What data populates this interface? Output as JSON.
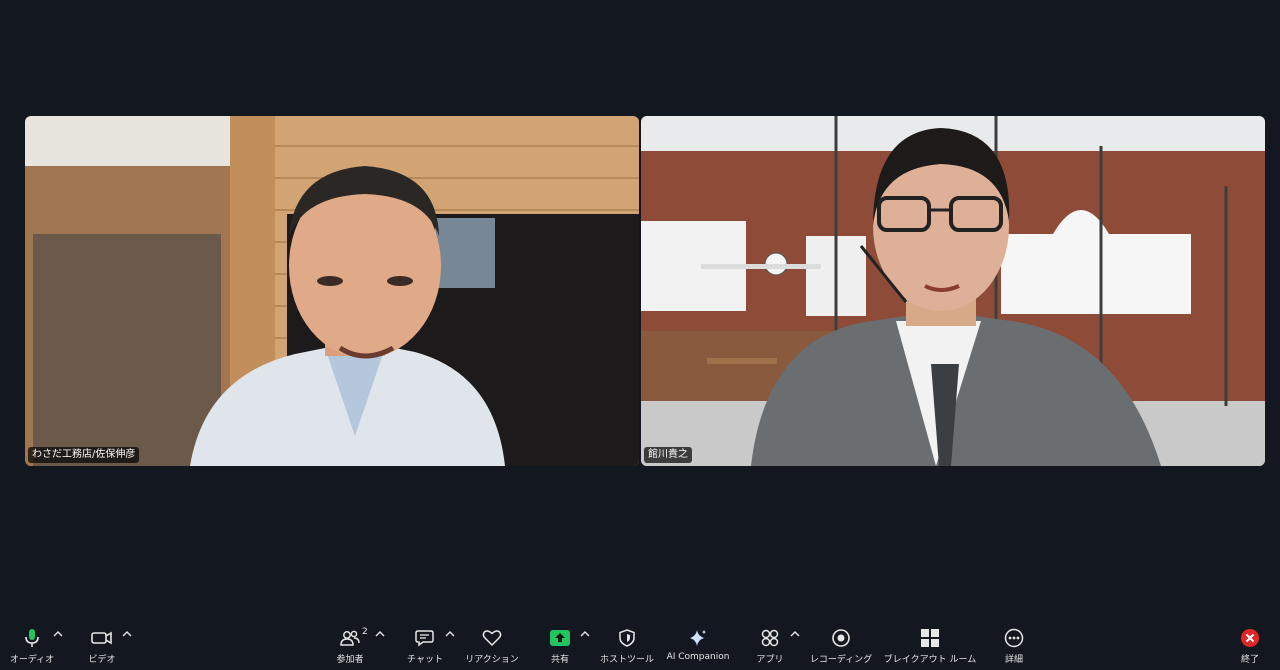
{
  "participants": [
    {
      "name": "わさだ工務店/佐保伸彦"
    },
    {
      "name": "館川貴之"
    }
  ],
  "toolbar": {
    "audio": {
      "label": "オーディオ",
      "icon": "microphone-icon"
    },
    "video": {
      "label": "ビデオ",
      "icon": "video-camera-icon"
    },
    "participants": {
      "label": "参加者",
      "count": "2",
      "icon": "participants-icon"
    },
    "chat": {
      "label": "チャット",
      "icon": "chat-icon"
    },
    "reactions": {
      "label": "リアクション",
      "icon": "heart-icon"
    },
    "share": {
      "label": "共有",
      "icon": "share-screen-icon",
      "accent": "#22c55e"
    },
    "host_tools": {
      "label": "ホストツール",
      "icon": "shield-icon"
    },
    "ai_companion": {
      "label": "AI Companion",
      "icon": "sparkle-icon"
    },
    "apps": {
      "label": "アプリ",
      "icon": "apps-icon"
    },
    "recording": {
      "label": "レコーディング",
      "icon": "record-icon"
    },
    "breakout": {
      "label": "ブレイクアウト ルーム",
      "icon": "breakout-rooms-icon"
    },
    "more": {
      "label": "詳細",
      "icon": "more-icon"
    },
    "end": {
      "label": "終了",
      "icon": "end-meeting-icon",
      "accent": "#e02828"
    }
  }
}
